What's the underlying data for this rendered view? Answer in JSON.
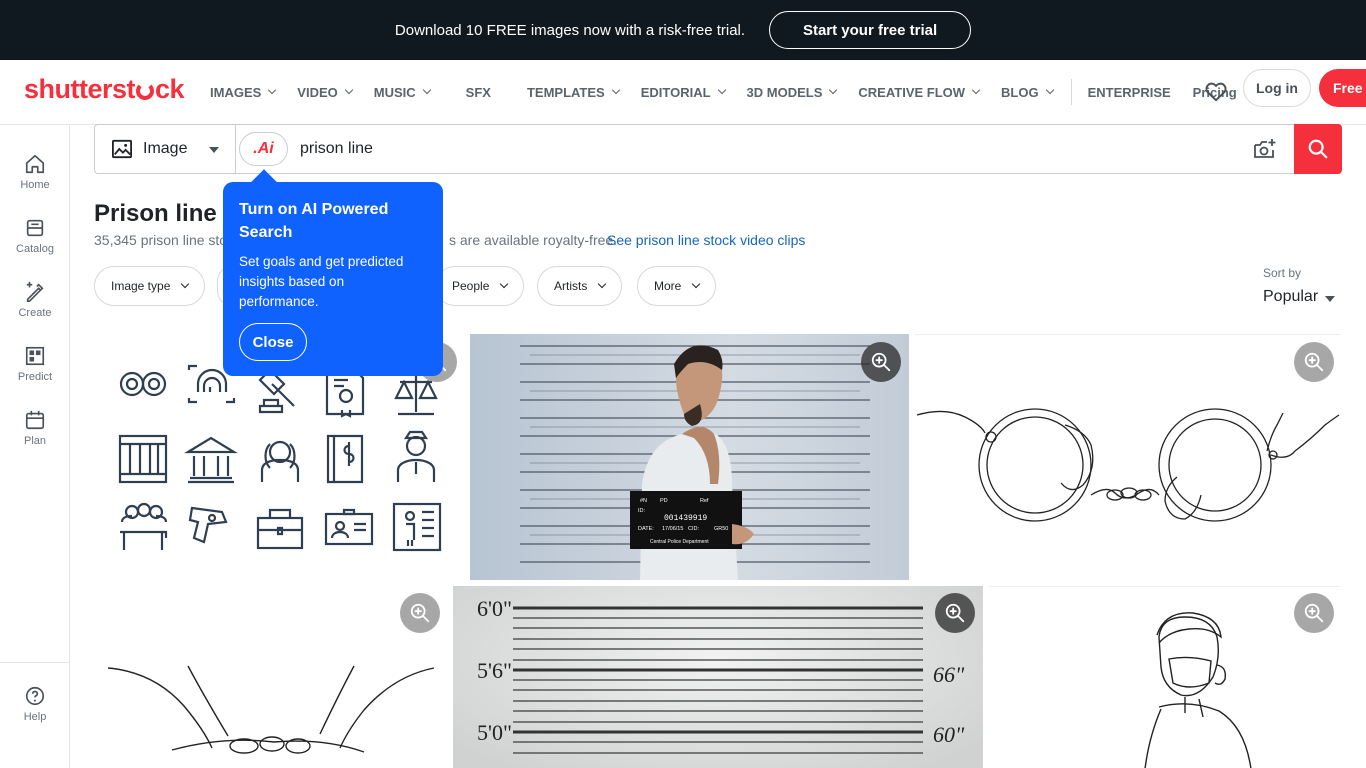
{
  "promo": {
    "text": "Download 10 FREE images now with a risk-free trial.",
    "button": "Start your free trial"
  },
  "header": {
    "logo_pre": "shutterst",
    "logo_post": "ck",
    "nav": [
      "IMAGES",
      "VIDEO",
      "MUSIC",
      "SFX",
      "TEMPLATES",
      "EDITORIAL",
      "3D MODELS",
      "CREATIVE FLOW",
      "BLOG",
      "ENTERPRISE",
      "Pricing"
    ],
    "login": "Log in",
    "free": "Free t"
  },
  "rail": {
    "home": "Home",
    "catalog": "Catalog",
    "create": "Create",
    "predict": "Predict",
    "plan": "Plan",
    "help": "Help"
  },
  "search": {
    "type": "Image",
    "ai_label": ".Ai",
    "query": "prison line"
  },
  "page": {
    "title": "Prison line r",
    "results_prefix": "35,345 prison line sto",
    "results_suffix": "s are available royalty-free.",
    "video_link": "See prison line stock video clips"
  },
  "filters": [
    "Image type",
    "People",
    "Artists",
    "More"
  ],
  "sort": {
    "label": "Sort by",
    "value": "Popular"
  },
  "tooltip": {
    "title": "Turn on AI Powered Search",
    "body": "Set goals and get predicted insights based on performance.",
    "close": "Close"
  },
  "mugshot": {
    "id": "001439919",
    "date": "17/06/15",
    "department": "Central Police Department",
    "heights": [
      "6'0\"",
      "5'6\"",
      "5'0\"",
      "66\"",
      "60\""
    ]
  },
  "colors": {
    "brand_red": "#f5303c",
    "tooltip_blue": "#0f62fe",
    "promo_bg": "#101820",
    "link_blue": "#1565c0"
  }
}
